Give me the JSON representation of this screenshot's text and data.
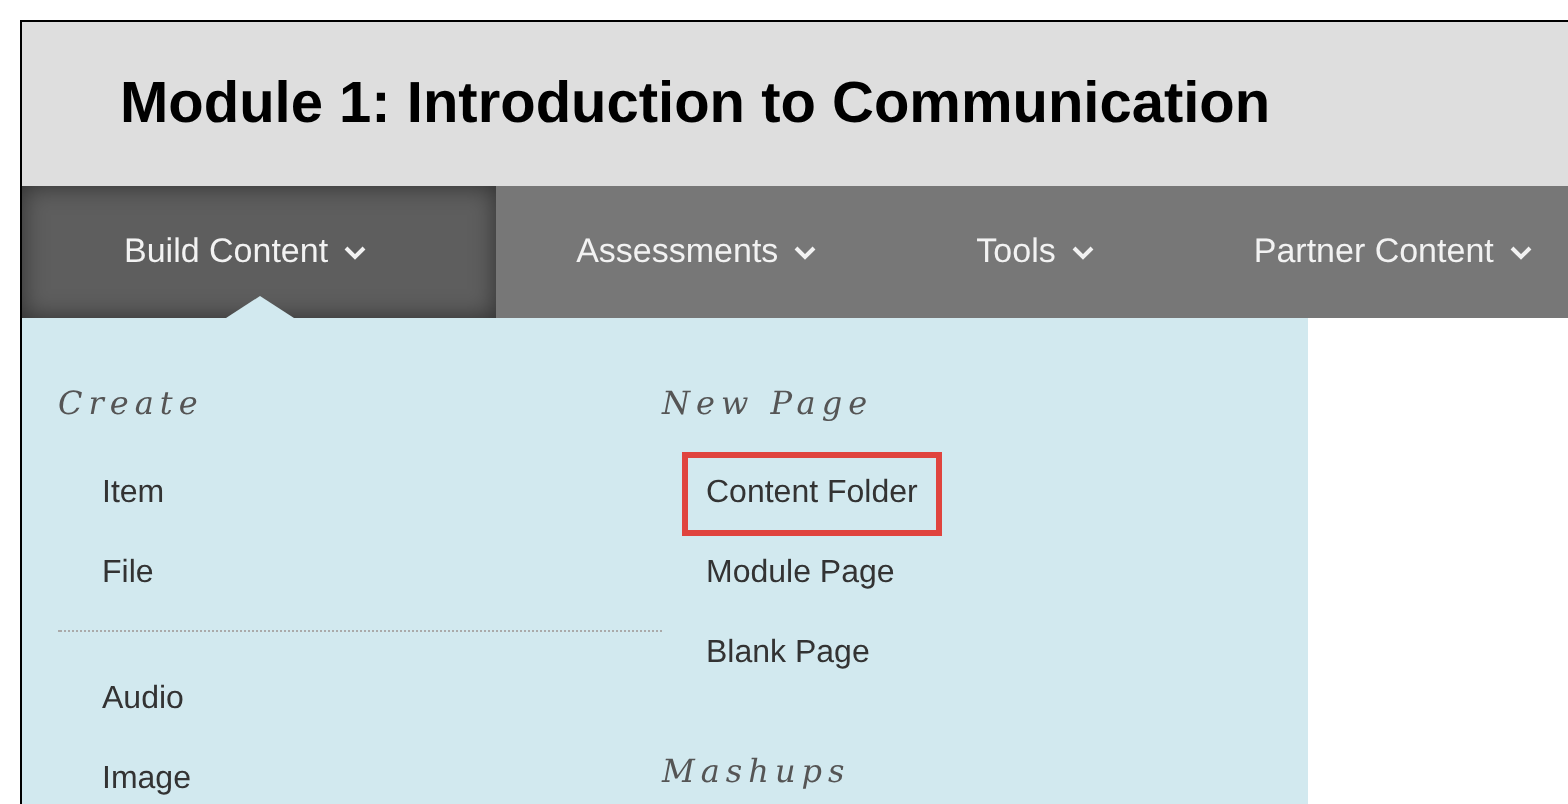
{
  "title": "Module 1: Introduction to Communication",
  "nav": [
    {
      "label": "Build Content",
      "selected": true
    },
    {
      "label": "Assessments",
      "selected": false
    },
    {
      "label": "Tools",
      "selected": false
    },
    {
      "label": "Partner Content",
      "selected": false
    }
  ],
  "menu": {
    "columns": [
      {
        "sections": [
          {
            "heading": "Create",
            "groups": [
              [
                {
                  "label": "Item",
                  "highlighted": false
                },
                {
                  "label": "File",
                  "highlighted": false
                }
              ],
              [
                {
                  "label": "Audio",
                  "highlighted": false
                },
                {
                  "label": "Image",
                  "highlighted": false
                }
              ]
            ]
          }
        ]
      },
      {
        "sections": [
          {
            "heading": "New Page",
            "groups": [
              [
                {
                  "label": "Content Folder",
                  "highlighted": true
                },
                {
                  "label": "Module Page",
                  "highlighted": false
                },
                {
                  "label": "Blank Page",
                  "highlighted": false
                }
              ]
            ]
          },
          {
            "heading": "Mashups"
          }
        ]
      }
    ]
  }
}
